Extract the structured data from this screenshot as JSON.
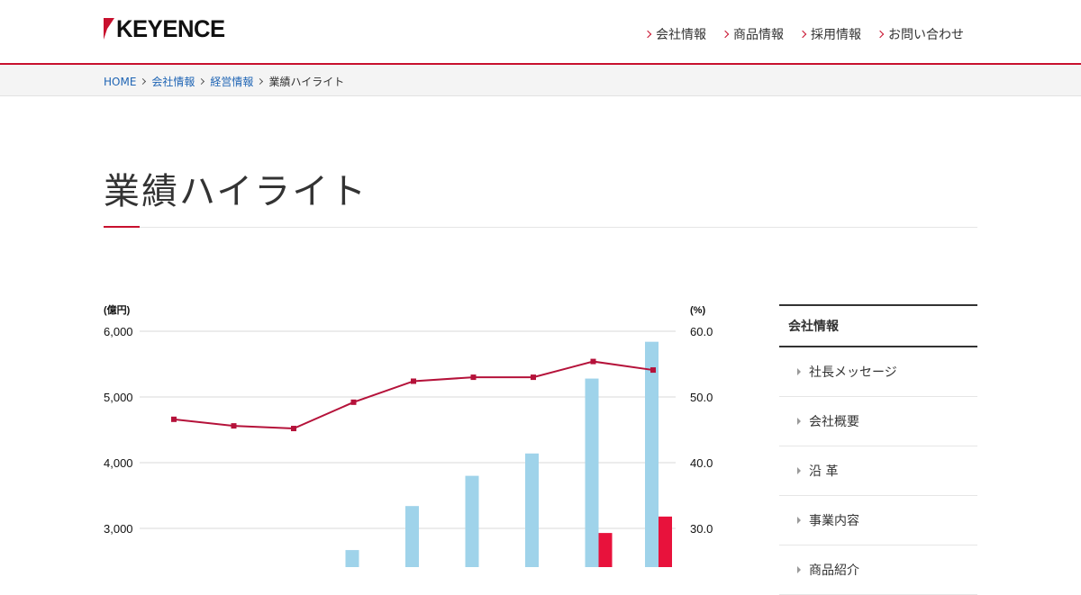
{
  "header": {
    "logo_text": "KEYENCE",
    "nav": [
      {
        "label": "会社情報"
      },
      {
        "label": "商品情報"
      },
      {
        "label": "採用情報"
      },
      {
        "label": "お問い合わせ"
      }
    ]
  },
  "breadcrumb": {
    "items": [
      {
        "label": "HOME"
      },
      {
        "label": "会社情報"
      },
      {
        "label": "経営情報"
      }
    ],
    "current": "業績ハイライト"
  },
  "page": {
    "title": "業績ハイライト"
  },
  "sidebar": {
    "heading": "会社情報",
    "items": [
      {
        "label": "社長メッセージ"
      },
      {
        "label": "会社概要"
      },
      {
        "label": "沿 革"
      },
      {
        "label": "事業内容"
      },
      {
        "label": "商品紹介"
      }
    ]
  },
  "colors": {
    "accent": "#c8102e",
    "bar_light": "#9fd3ea",
    "bar_red": "#e8123c",
    "link": "#1e64b4"
  },
  "chart_data": {
    "type": "bar",
    "left_unit_label": "(億円)",
    "right_unit_label": "(%)",
    "left_axis": {
      "ticks": [
        6000,
        5000,
        4000,
        3000
      ],
      "tick_labels": [
        "6,000",
        "5,000",
        "4,000",
        "3,000"
      ],
      "ylim_visible": [
        2450,
        6340
      ]
    },
    "right_axis": {
      "ticks": [
        60.0,
        50.0,
        40.0,
        30.0
      ],
      "tick_labels": [
        "60.0",
        "50.0",
        "40.0",
        "30.0"
      ],
      "ylim_visible": [
        24.5,
        63.4
      ]
    },
    "series": [
      {
        "axis": "left",
        "type": "bar",
        "color": "#9fd3ea",
        "values": [
          null,
          null,
          null,
          2670,
          3340,
          3800,
          4140,
          5280,
          5840
        ]
      },
      {
        "axis": "left",
        "type": "bar",
        "color": "#e8123c",
        "values": [
          null,
          null,
          null,
          null,
          null,
          null,
          null,
          2930,
          3180
        ]
      },
      {
        "axis": "right",
        "type": "line",
        "color": "#b5123a",
        "values": [
          46.6,
          45.6,
          45.2,
          49.2,
          52.4,
          53.0,
          53.0,
          55.4,
          54.1
        ]
      }
    ],
    "grid": true
  }
}
